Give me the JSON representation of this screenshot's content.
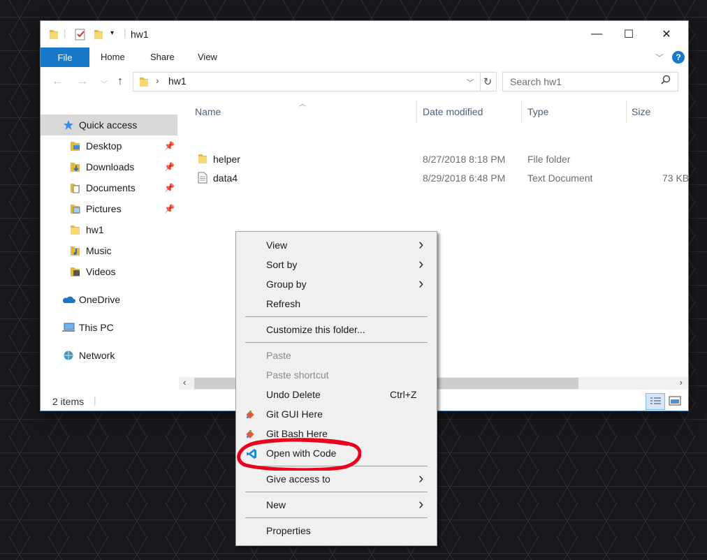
{
  "window": {
    "title": "hw1",
    "controls": {
      "minimize": "—",
      "maximize": "☐",
      "close": "✕"
    }
  },
  "ribbon": {
    "file": "File",
    "tabs": [
      "Home",
      "Share",
      "View"
    ],
    "help": "?"
  },
  "address": {
    "path": "hw1",
    "search_placeholder": "Search hw1"
  },
  "sidebar": {
    "items": [
      {
        "label": "Quick access",
        "icon": "star-icon",
        "selected": true,
        "pinned": false
      },
      {
        "label": "Desktop",
        "icon": "desktop-folder-icon",
        "pinned": true
      },
      {
        "label": "Downloads",
        "icon": "downloads-folder-icon",
        "pinned": true
      },
      {
        "label": "Documents",
        "icon": "documents-folder-icon",
        "pinned": true
      },
      {
        "label": "Pictures",
        "icon": "pictures-folder-icon",
        "pinned": true
      },
      {
        "label": "hw1",
        "icon": "folder-icon",
        "pinned": false
      },
      {
        "label": "Music",
        "icon": "music-folder-icon",
        "pinned": false
      },
      {
        "label": "Videos",
        "icon": "videos-folder-icon",
        "pinned": false
      },
      {
        "label": "OneDrive",
        "icon": "onedrive-icon",
        "pinned": false
      },
      {
        "label": "This PC",
        "icon": "this-pc-icon",
        "pinned": false
      },
      {
        "label": "Network",
        "icon": "network-icon",
        "pinned": false
      }
    ]
  },
  "columns": {
    "name": "Name",
    "date": "Date modified",
    "type": "Type",
    "size": "Size"
  },
  "files": [
    {
      "name": "helper",
      "date": "8/27/2018 8:18 PM",
      "type": "File folder",
      "size": "",
      "icon": "folder-icon"
    },
    {
      "name": "data4",
      "date": "8/29/2018 6:48 PM",
      "type": "Text Document",
      "size": "73 KB",
      "icon": "text-file-icon"
    }
  ],
  "status": {
    "items": "2 items"
  },
  "context_menu": {
    "view": "View",
    "sort_by": "Sort by",
    "group_by": "Group by",
    "refresh": "Refresh",
    "customize": "Customize this folder...",
    "paste": "Paste",
    "paste_shortcut": "Paste shortcut",
    "undo_delete": "Undo Delete",
    "undo_shortcut": "Ctrl+Z",
    "git_gui": "Git GUI Here",
    "git_bash": "Git Bash Here",
    "open_with_code": "Open with Code",
    "give_access": "Give access to",
    "new": "New",
    "properties": "Properties"
  },
  "colors": {
    "accent": "#1979ca",
    "annotation": "#e8001c",
    "menu_bg": "#f0f0f0"
  }
}
